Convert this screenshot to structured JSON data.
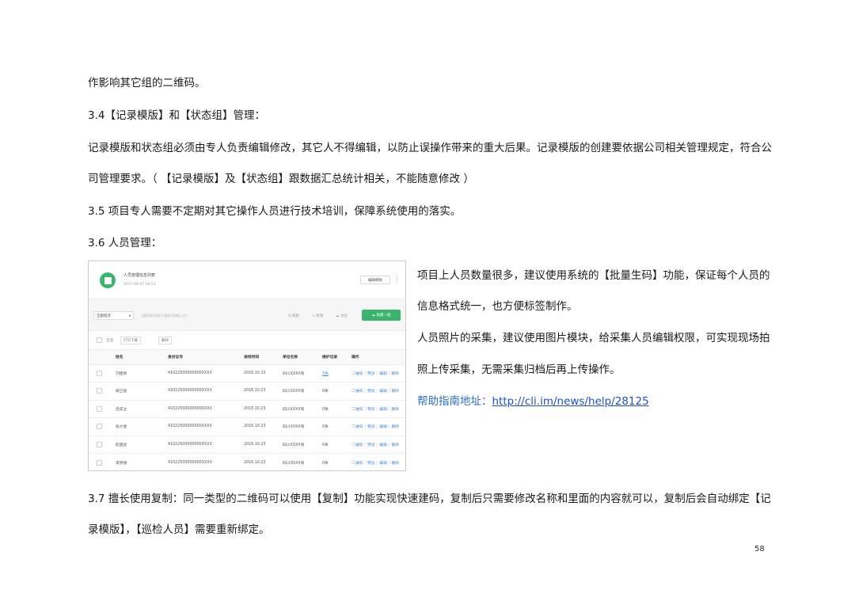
{
  "doc": {
    "line1": "作影响其它组的二维码。",
    "line2": "3.4【记录模版】和【状态组】管理：",
    "line3": "记录模版和状态组必须由专人负责编辑修改，其它人不得编辑，以防止误操作带来的重大后果。记录模版的创建要依据公司相关管理规定，符合公",
    "line4": "司管理要求。（ 【记录模版】及【状态组】跟数据汇总统计相关，不能随意修改 ）",
    "line5": "3.5 项目专人需要不定期对其它操作人员进行技术培训，保障系统使用的落实。",
    "line6": "3.6 人员管理：",
    "side1": "项目上人员数量很多，建议使用系统的【批量生码】功能，保证每个人员的",
    "side2": "信息格式统一，也方便标签制作。",
    "side3": "人员照片的采集，建议使用图片模块，给采集人员编辑权限，可实现现场拍",
    "side4": "照上传采集，无需采集归档后再上传操作。",
    "help_label": "帮助指南地址：",
    "help_url": "http://cli.im/news/help/28125",
    "line7": "3.7 擅长使用复制：同一类型的二维码可以使用【复制】功能实现快速建码，复制后只需要修改名称和里面的内容就可以，复制后会自动绑定【记",
    "line8": "录模版】，【巡检人员】需要重新绑定。",
    "page_number": "58"
  },
  "screenshot": {
    "title": "人员管理信息列表",
    "date": "2017-06-07 16:51",
    "edit_button": "编辑模板",
    "more": "⋮",
    "filter": "全部批次",
    "filter_caret": "▾",
    "search_hint": "当前检索名称/二维码  [回填入口]",
    "search": "Q 搜索",
    "add": "+ 新增",
    "export": "☁ 导出",
    "new_button": "☁ 再建一批",
    "select_all": "全选",
    "print_button": "打包下载",
    "delete_button": "删除",
    "columns": [
      "姓名",
      "身份证号",
      "进场时间",
      "单位名称",
      "维护记录",
      "操作"
    ],
    "rows": [
      {
        "name": "刘建新",
        "id": "41022500000000XXXX",
        "time": "2016.10.23",
        "unit": "四川XXXX有",
        "record": "3条"
      },
      {
        "name": "胡卫星",
        "id": "41022500000000XXXX",
        "time": "2016.10.23",
        "unit": "四川XXXX有",
        "record": "0条"
      },
      {
        "name": "吕成立",
        "id": "41022500000000XXXX",
        "time": "2016.10.23",
        "unit": "四川XXXX有",
        "record": "0条"
      },
      {
        "name": "张大星",
        "id": "41022500000000XXXX",
        "time": "2016.10.23",
        "unit": "四川XXXX有",
        "record": "0条"
      },
      {
        "name": "赵国亮",
        "id": "41022500000000XXXX",
        "time": "2016.10.23",
        "unit": "四川XXXX有",
        "record": "0条"
      },
      {
        "name": "李贵德",
        "id": "41022500000000XXXX",
        "time": "2016.10.23",
        "unit": "四川XXXX有",
        "record": "0条"
      }
    ],
    "ops": {
      "qr": "二维码",
      "preview": "预览",
      "edit": "编辑",
      "delete": "删除",
      "sep": "|"
    },
    "colors": {
      "green": "#3bb56b",
      "link": "#4a8bd6"
    }
  }
}
